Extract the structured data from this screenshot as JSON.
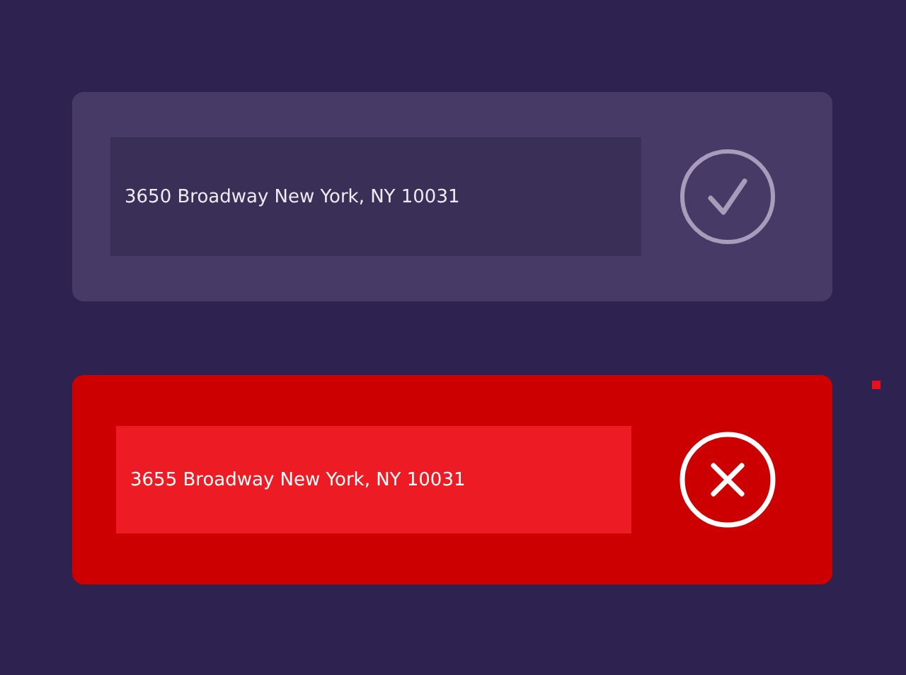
{
  "entries": [
    {
      "address": "3650 Broadway New York, NY 10031",
      "kind": "valid"
    },
    {
      "address": "3655 Broadway New York, NY 10031",
      "kind": "invalid"
    }
  ]
}
